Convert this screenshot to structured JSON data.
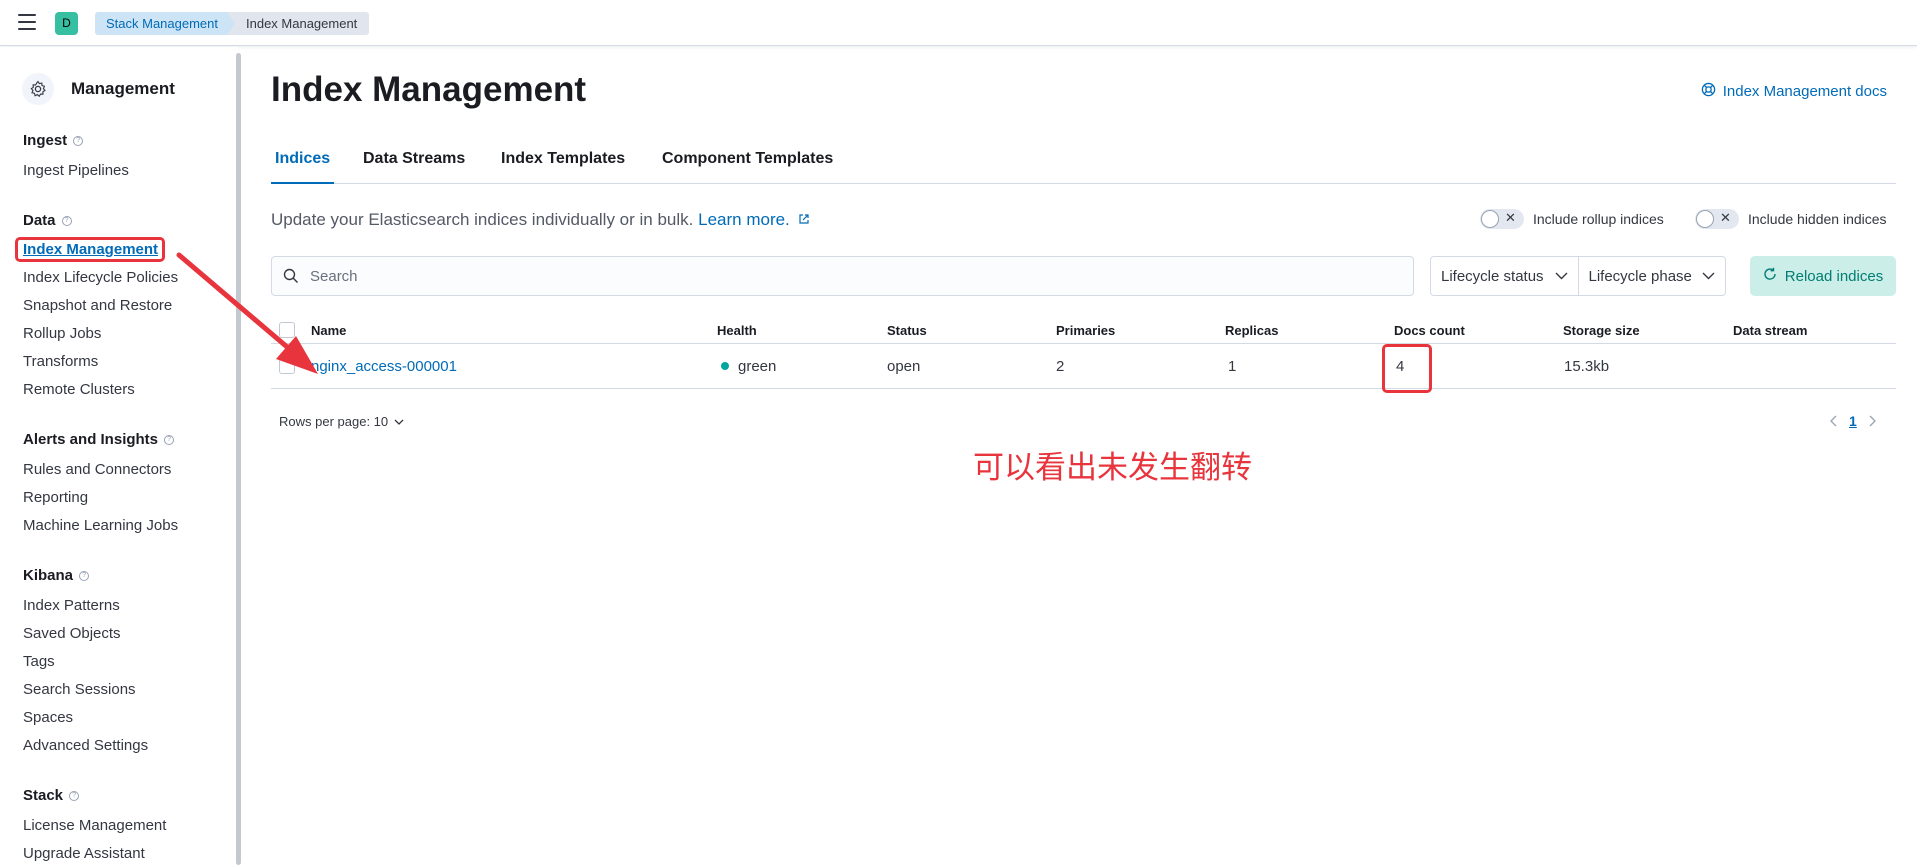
{
  "header": {
    "space_initial": "D",
    "breadcrumbs": [
      "Stack Management",
      "Index Management"
    ]
  },
  "sidebar": {
    "title": "Management",
    "groups": [
      {
        "label": "Ingest",
        "items": [
          "Ingest Pipelines"
        ]
      },
      {
        "label": "Data",
        "items": [
          "Index Management",
          "Index Lifecycle Policies",
          "Snapshot and Restore",
          "Rollup Jobs",
          "Transforms",
          "Remote Clusters"
        ]
      },
      {
        "label": "Alerts and Insights",
        "items": [
          "Rules and Connectors",
          "Reporting",
          "Machine Learning Jobs"
        ]
      },
      {
        "label": "Kibana",
        "items": [
          "Index Patterns",
          "Saved Objects",
          "Tags",
          "Search Sessions",
          "Spaces",
          "Advanced Settings"
        ]
      },
      {
        "label": "Stack",
        "items": [
          "License Management",
          "Upgrade Assistant"
        ]
      }
    ],
    "active_item": "Index Management"
  },
  "main": {
    "title": "Index Management",
    "docs_link": "Index Management docs",
    "tabs": [
      "Indices",
      "Data Streams",
      "Index Templates",
      "Component Templates"
    ],
    "active_tab": "Indices",
    "description": "Update your Elasticsearch indices individually or in bulk.",
    "learn_more": "Learn more.",
    "toggles": [
      "Include rollup indices",
      "Include hidden indices"
    ],
    "search_placeholder": "Search",
    "filters": [
      "Lifecycle status",
      "Lifecycle phase"
    ],
    "reload_label": "Reload indices",
    "table": {
      "columns": [
        "Name",
        "Health",
        "Status",
        "Primaries",
        "Replicas",
        "Docs count",
        "Storage size",
        "Data stream"
      ],
      "rows": [
        {
          "name": "nginx_access-000001",
          "health": "green",
          "status": "open",
          "primaries": "2",
          "replicas": "1",
          "docs_count": "4",
          "storage_size": "15.3kb",
          "data_stream": ""
        }
      ]
    },
    "rows_per_page": "Rows per page: 10",
    "current_page": "1"
  },
  "annotation": {
    "text": "可以看出未发生翻转",
    "color": "#e8343c"
  },
  "colors": {
    "accent": "#006bb8",
    "health_green": "#00a69b",
    "reload_bg": "#cbeee9"
  }
}
